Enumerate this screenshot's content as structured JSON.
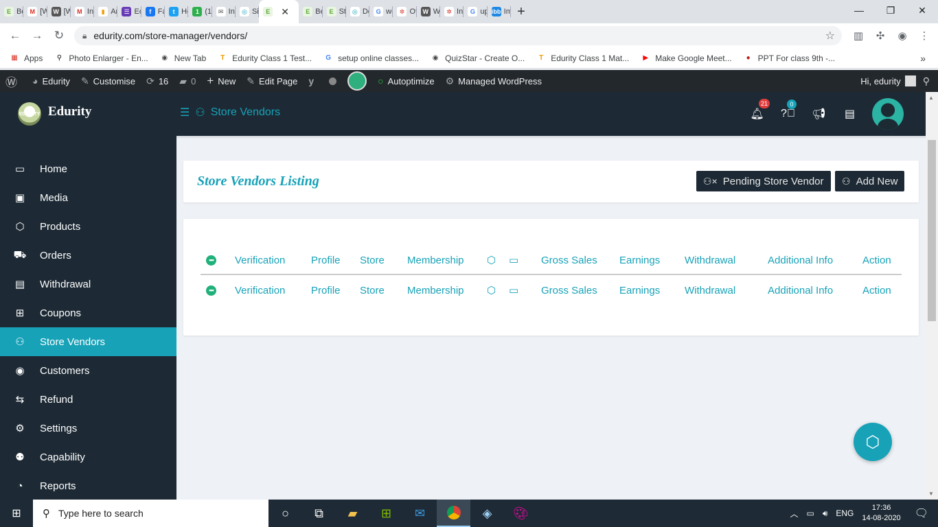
{
  "browser": {
    "tabs": [
      {
        "label": "Bo",
        "fav": "E",
        "favbg": "#e8f5e0",
        "favfg": "#5da83a"
      },
      {
        "label": "[W",
        "fav": "M",
        "favbg": "#fff",
        "favfg": "#d93025"
      },
      {
        "label": "[W",
        "fav": "W",
        "favbg": "#555",
        "favfg": "#fff"
      },
      {
        "label": "Inl",
        "fav": "M",
        "favbg": "#fff",
        "favfg": "#d93025"
      },
      {
        "label": "An",
        "fav": "▮",
        "favbg": "#fff",
        "favfg": "#f29900"
      },
      {
        "label": "Ed",
        "fav": "☰",
        "favbg": "#673ab7",
        "favfg": "#fff"
      },
      {
        "label": "Fa",
        "fav": "f",
        "favbg": "#1877f2",
        "favfg": "#fff"
      },
      {
        "label": "Hc",
        "fav": "t",
        "favbg": "#1da1f2",
        "favfg": "#fff"
      },
      {
        "label": "(1)",
        "fav": "1",
        "favbg": "#2eaf4c",
        "favfg": "#fff"
      },
      {
        "label": "Inl",
        "fav": "✉",
        "favbg": "#fff",
        "favfg": "#555"
      },
      {
        "label": "Sig",
        "fav": "◎",
        "favbg": "#fff",
        "favfg": "#17a2b8"
      },
      {
        "label": "",
        "fav": "E",
        "favbg": "#e8f5e0",
        "favfg": "#5da83a",
        "active": true
      },
      {
        "label": "Be",
        "fav": "E",
        "favbg": "#e8f5e0",
        "favfg": "#5da83a"
      },
      {
        "label": "Stc",
        "fav": "E",
        "favbg": "#e8f5e0",
        "favfg": "#5da83a"
      },
      {
        "label": "Dc",
        "fav": "◎",
        "favbg": "#fff",
        "favfg": "#17a2b8"
      },
      {
        "label": "wc",
        "fav": "G",
        "favbg": "#fff",
        "favfg": "#4285f4"
      },
      {
        "label": "Of",
        "fav": "✲",
        "favbg": "#fff",
        "favfg": "#d93025"
      },
      {
        "label": "Wc",
        "fav": "W",
        "favbg": "#555",
        "favfg": "#fff"
      },
      {
        "label": "Ins",
        "fav": "✲",
        "favbg": "#fff",
        "favfg": "#d93025"
      },
      {
        "label": "up",
        "fav": "G",
        "favbg": "#fff",
        "favfg": "#4285f4"
      },
      {
        "label": "Im",
        "fav": "ibb",
        "favbg": "#1e88e5",
        "favfg": "#fff"
      }
    ],
    "url": "edurity.com/store-manager/vendors/",
    "bookmarks": [
      {
        "label": "Apps",
        "icon": "▦",
        "color": "#d93025"
      },
      {
        "label": "Photo Enlarger - En...",
        "icon": "⚲",
        "color": "#111"
      },
      {
        "label": "New Tab",
        "icon": "◉",
        "color": "#444"
      },
      {
        "label": "Edurity Class 1 Test...",
        "icon": "T",
        "color": "#f29900"
      },
      {
        "label": "setup online classes...",
        "icon": "G",
        "color": "#4285f4"
      },
      {
        "label": "QuizStar - Create O...",
        "icon": "◉",
        "color": "#444"
      },
      {
        "label": "Edurity Class 1 Mat...",
        "icon": "T",
        "color": "#f29900"
      },
      {
        "label": "Make Google Meet...",
        "icon": "▶",
        "color": "#ff0000"
      },
      {
        "label": "PPT For class 9th -...",
        "icon": "●",
        "color": "#b71c1c"
      }
    ]
  },
  "wpbar": {
    "site": "Edurity",
    "customise": "Customise",
    "updates": "16",
    "comments": "0",
    "new": "New",
    "edit": "Edit Page",
    "autoptimize": "Autoptimize",
    "managed": "Managed WordPress",
    "greeting": "Hi, edurity"
  },
  "header": {
    "brand": "Edurity",
    "logo_text": "EDURITY",
    "crumb": "Store Vendors",
    "notifications_count": "21",
    "help_count": "0"
  },
  "sidebar": {
    "items": [
      {
        "label": "Home",
        "icon": "▭"
      },
      {
        "label": "Media",
        "icon": "▣"
      },
      {
        "label": "Products",
        "icon": "⬡"
      },
      {
        "label": "Orders",
        "icon": "⛟"
      },
      {
        "label": "Withdrawal",
        "icon": "▤"
      },
      {
        "label": "Coupons",
        "icon": "⊞"
      },
      {
        "label": "Store Vendors",
        "icon": "⚇",
        "active": true
      },
      {
        "label": "Customers",
        "icon": "◉"
      },
      {
        "label": "Refund",
        "icon": "⇆"
      },
      {
        "label": "Settings",
        "icon": "⚙"
      },
      {
        "label": "Capability",
        "icon": "⚉"
      },
      {
        "label": "Reports",
        "icon": "◔"
      }
    ]
  },
  "main": {
    "title": "Store Vendors Listing",
    "pending_button": "Pending Store Vendor",
    "add_button": "Add New",
    "columns": [
      "Verification",
      "Profile",
      "Store",
      "Membership",
      "Gross Sales",
      "Earnings",
      "Withdrawal",
      "Additional Info",
      "Action"
    ]
  },
  "taskbar": {
    "search_placeholder": "Type here to search",
    "lang": "ENG",
    "time": "17:36",
    "date": "14-08-2020"
  },
  "colors": {
    "accent": "#17a2b8",
    "dark": "#1d2a35",
    "status_green": "#20b07a"
  }
}
